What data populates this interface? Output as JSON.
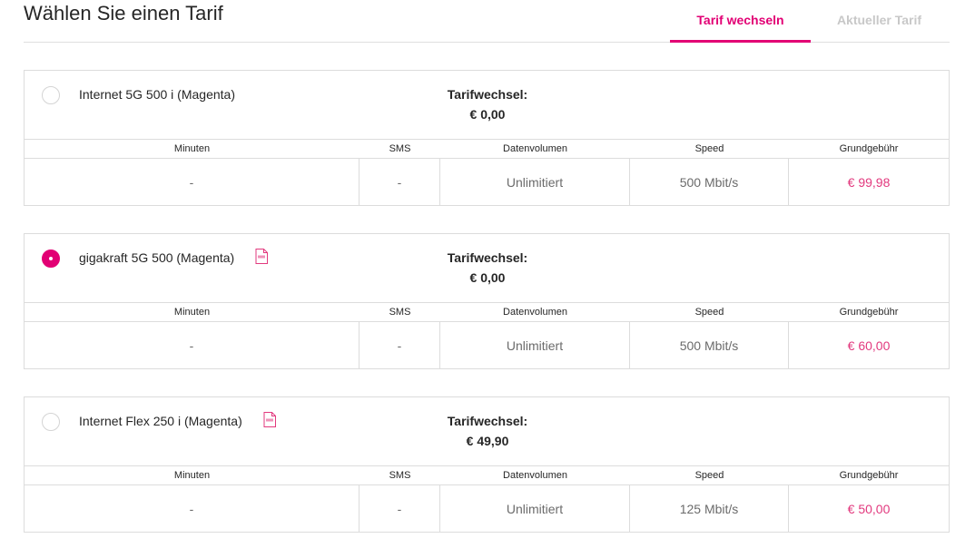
{
  "header": {
    "title": "Wählen Sie einen Tarif",
    "tabs": [
      {
        "label": "Tarif wechseln",
        "active": true
      },
      {
        "label": "Aktueller Tarif",
        "active": false
      }
    ]
  },
  "columns": [
    "Minuten",
    "SMS",
    "Datenvolumen",
    "Speed",
    "Grundgebühr"
  ],
  "plans": [
    {
      "name": "Internet 5G 500 i (Magenta)",
      "selected": false,
      "has_pdf": false,
      "change_label": "Tarifwechsel:",
      "change_value": "€ 0,00",
      "minuten": "-",
      "sms": "-",
      "datenvolumen": "Unlimitiert",
      "speed": "500 Mbit/s",
      "grundgebuehr": "€ 99,98"
    },
    {
      "name": "gigakraft 5G 500 (Magenta)",
      "selected": true,
      "has_pdf": true,
      "change_label": "Tarifwechsel:",
      "change_value": "€ 0,00",
      "minuten": "-",
      "sms": "-",
      "datenvolumen": "Unlimitiert",
      "speed": "500 Mbit/s",
      "grundgebuehr": "€ 60,00"
    },
    {
      "name": "Internet Flex 250 i (Magenta)",
      "selected": false,
      "has_pdf": true,
      "change_label": "Tarifwechsel:",
      "change_value": "€ 49,90",
      "minuten": "-",
      "sms": "-",
      "datenvolumen": "Unlimitiert",
      "speed": "125 Mbit/s",
      "grundgebuehr": "€ 50,00"
    }
  ],
  "colors": {
    "accent": "#e20074",
    "price": "#e2397e",
    "border": "#dcdcdc",
    "inactive_tab": "#c8c8c8"
  },
  "icons": {
    "pdf": "pdf-document-icon",
    "radio_selected": "radio-selected-icon",
    "radio_unselected": "radio-unselected-icon"
  }
}
